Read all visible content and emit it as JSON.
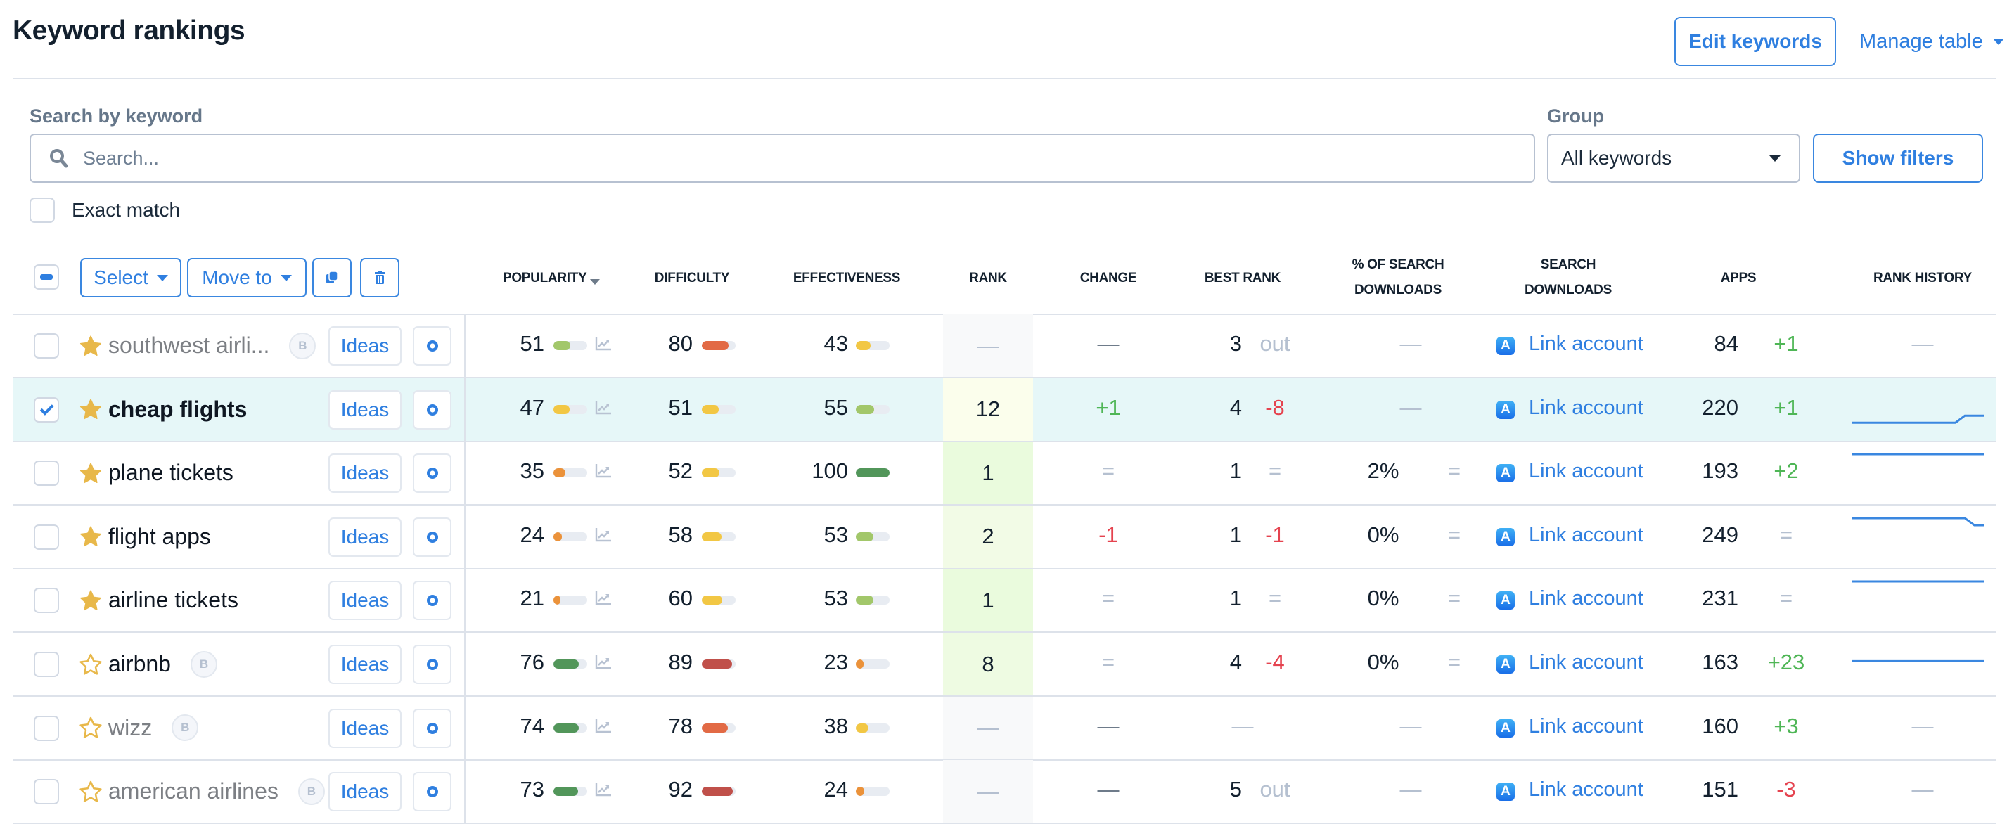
{
  "header": {
    "title": "Keyword rankings",
    "edit_keywords": "Edit keywords",
    "manage_table": "Manage table"
  },
  "search": {
    "label": "Search by keyword",
    "placeholder": "Search...",
    "value": ""
  },
  "group": {
    "label": "Group",
    "selected": "All keywords"
  },
  "show_filters": "Show filters",
  "exact_match": {
    "label": "Exact match",
    "checked": false
  },
  "toolbar": {
    "select": "Select",
    "move_to": "Move to",
    "copy_icon": "copy-icon",
    "delete_icon": "trash-icon"
  },
  "columns": {
    "popularity": "POPULARITY",
    "difficulty": "DIFFICULTY",
    "effectiveness": "EFFECTIVENESS",
    "rank": "RANK",
    "change": "CHANGE",
    "best_rank": "BEST RANK",
    "pct_search_downloads_1": "% OF SEARCH",
    "pct_search_downloads_2": "DOWNLOADS",
    "search_downloads_1": "SEARCH",
    "search_downloads_2": "DOWNLOADS",
    "apps": "APPS",
    "rank_history": "RANK HISTORY"
  },
  "ideas_label": "Ideas",
  "link_account_label": "Link account",
  "colors": {
    "accent": "#2f7fe0",
    "positive": "#4fb656",
    "negative": "#e5434f",
    "selected_row": "#e6f7f8",
    "star": "#e8b84a"
  },
  "rows": [
    {
      "keyword": "southwest airli...",
      "style": "muted",
      "starred": true,
      "badge": "B",
      "checked": false,
      "popularity": "51",
      "pop_color": "#a2c76a",
      "difficulty": "80",
      "diff_color": "#e26a45",
      "effectiveness": "43",
      "eff_color": "#f2c744",
      "rank": "—",
      "rank_bg": "#f8f9fa",
      "change": "—",
      "change_type": "dash-dark",
      "best_rank": "3",
      "best_delta": "out",
      "best_delta_type": "out",
      "pct_search": "—",
      "pct_eq": "",
      "apps": "84",
      "apps_delta": "+1",
      "apps_delta_type": "pos",
      "history": null
    },
    {
      "keyword": "cheap flights",
      "style": "bold",
      "starred": true,
      "badge": "",
      "checked": true,
      "popularity": "47",
      "pop_color": "#f2c744",
      "difficulty": "51",
      "diff_color": "#f2c744",
      "effectiveness": "55",
      "eff_color": "#a2c76a",
      "rank": "12",
      "rank_bg": "#fbfeec",
      "change": "+1",
      "change_type": "pos",
      "best_rank": "4",
      "best_delta": "-8",
      "best_delta_type": "neg",
      "pct_search": "—",
      "pct_eq": "",
      "apps": "220",
      "apps_delta": "+1",
      "apps_delta_type": "pos",
      "history": [
        13,
        13,
        13,
        13,
        13,
        13,
        13,
        13,
        13,
        13,
        13,
        13,
        12,
        12,
        12
      ]
    },
    {
      "keyword": "plane tickets",
      "style": "normal",
      "starred": true,
      "badge": "",
      "checked": false,
      "popularity": "35",
      "pop_color": "#eb923a",
      "difficulty": "52",
      "diff_color": "#f2c744",
      "effectiveness": "100",
      "eff_color": "#52965a",
      "rank": "1",
      "rank_bg": "#eafbdd",
      "change": "=",
      "change_type": "eq",
      "best_rank": "1",
      "best_delta": "=",
      "best_delta_type": "eq",
      "pct_search": "2%",
      "pct_eq": "=",
      "apps": "193",
      "apps_delta": "+2",
      "apps_delta_type": "pos",
      "history": [
        1,
        1,
        1,
        1,
        1,
        1,
        1,
        1,
        1,
        1,
        1,
        1,
        1,
        1,
        1
      ]
    },
    {
      "keyword": "flight apps",
      "style": "normal",
      "starred": true,
      "badge": "",
      "checked": false,
      "popularity": "24",
      "pop_color": "#eb923a",
      "difficulty": "58",
      "diff_color": "#f2c744",
      "effectiveness": "53",
      "eff_color": "#a2c76a",
      "rank": "2",
      "rank_bg": "#f2fbe6",
      "change": "-1",
      "change_type": "neg",
      "best_rank": "1",
      "best_delta": "-1",
      "best_delta_type": "neg",
      "pct_search": "0%",
      "pct_eq": "=",
      "apps": "249",
      "apps_delta": "=",
      "apps_delta_type": "eq",
      "history": [
        1,
        1,
        1,
        1,
        1,
        1,
        1,
        1,
        1,
        1,
        1,
        1,
        1,
        2,
        2
      ]
    },
    {
      "keyword": "airline tickets",
      "style": "normal",
      "starred": true,
      "badge": "",
      "checked": false,
      "popularity": "21",
      "pop_color": "#eb923a",
      "difficulty": "60",
      "diff_color": "#f2c744",
      "effectiveness": "53",
      "eff_color": "#a2c76a",
      "rank": "1",
      "rank_bg": "#eafbdd",
      "change": "=",
      "change_type": "eq",
      "best_rank": "1",
      "best_delta": "=",
      "best_delta_type": "eq",
      "pct_search": "0%",
      "pct_eq": "=",
      "apps": "231",
      "apps_delta": "=",
      "apps_delta_type": "eq",
      "history": [
        1,
        1,
        1,
        1,
        1,
        1,
        1,
        1,
        1,
        1,
        1,
        1,
        1,
        1,
        1
      ]
    },
    {
      "keyword": "airbnb",
      "style": "normal",
      "starred": false,
      "badge": "B",
      "checked": false,
      "popularity": "76",
      "pop_color": "#52965a",
      "difficulty": "89",
      "diff_color": "#c0504a",
      "effectiveness": "23",
      "eff_color": "#eb923a",
      "rank": "8",
      "rank_bg": "#eefbe2",
      "change": "=",
      "change_type": "eq",
      "best_rank": "4",
      "best_delta": "-4",
      "best_delta_type": "neg",
      "pct_search": "0%",
      "pct_eq": "=",
      "apps": "163",
      "apps_delta": "+23",
      "apps_delta_type": "pos",
      "history": [
        8,
        8,
        8,
        8,
        8,
        8,
        8,
        8,
        8,
        8,
        8,
        8,
        8,
        8,
        8
      ]
    },
    {
      "keyword": "wizz",
      "style": "muted",
      "starred": false,
      "badge": "B",
      "checked": false,
      "popularity": "74",
      "pop_color": "#52965a",
      "difficulty": "78",
      "diff_color": "#e26a45",
      "effectiveness": "38",
      "eff_color": "#f2c744",
      "rank": "—",
      "rank_bg": "#f8f9fa",
      "change": "—",
      "change_type": "dash-dark",
      "best_rank": "—",
      "best_delta": "",
      "best_delta_type": "dash",
      "pct_search": "—",
      "pct_eq": "",
      "apps": "160",
      "apps_delta": "+3",
      "apps_delta_type": "pos",
      "history": null
    },
    {
      "keyword": "american airlines",
      "style": "muted",
      "starred": false,
      "badge": "B",
      "checked": false,
      "popularity": "73",
      "pop_color": "#52965a",
      "difficulty": "92",
      "diff_color": "#c0504a",
      "effectiveness": "24",
      "eff_color": "#eb923a",
      "rank": "—",
      "rank_bg": "#f8f9fa",
      "change": "—",
      "change_type": "dash-dark",
      "best_rank": "5",
      "best_delta": "out",
      "best_delta_type": "out",
      "pct_search": "—",
      "pct_eq": "",
      "apps": "151",
      "apps_delta": "-3",
      "apps_delta_type": "neg",
      "history": null
    }
  ]
}
